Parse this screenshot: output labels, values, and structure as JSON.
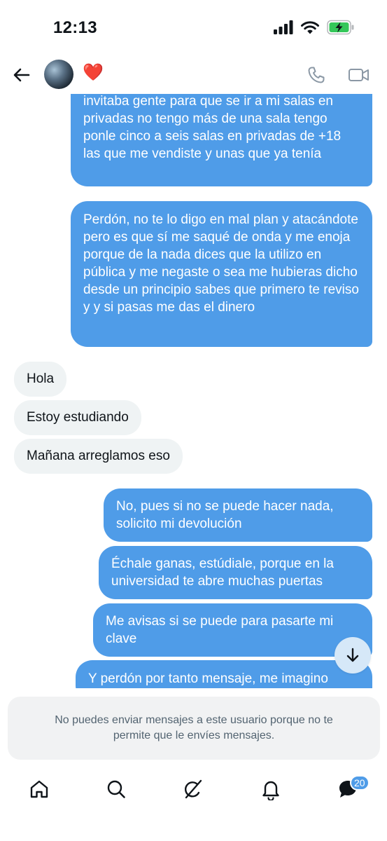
{
  "status_bar": {
    "time": "12:13",
    "icons": [
      "cellular-signal-icon",
      "wifi-icon",
      "battery-charging-icon"
    ],
    "battery_color": "#34c759"
  },
  "header": {
    "icons": [
      "back-arrow-icon",
      "phone-icon",
      "video-camera-icon"
    ],
    "status_emoji": "❤️"
  },
  "messages": [
    {
      "side": "out",
      "text": "invitaba gente para que se ir a mi salas en privadas no tengo más de una sala tengo ponle cinco a seis salas en privadas de +18 las que me vendiste y unas que ya tenía"
    },
    {
      "side": "out",
      "text": "Perdón, no te lo digo en mal plan y atacándote pero es que sí me saqué de onda y me enoja porque de la nada dices que la utilizo en pública y me negaste o sea me hubieras dicho desde un principio sabes que primero te reviso y y si pasas me das el dinero"
    },
    {
      "side": "in",
      "text": "Hola"
    },
    {
      "side": "in",
      "text": "Estoy estudiando"
    },
    {
      "side": "in",
      "text": "Mañana arreglamos eso"
    },
    {
      "side": "out",
      "text": "No, pues si no se puede hacer nada, solicito mi devolución"
    },
    {
      "side": "out",
      "text": "Échale ganas, estúdiale, porque en la universidad te abre muchas puertas"
    },
    {
      "side": "out",
      "text": "Me avisas si se puede para pasarte mi clave"
    },
    {
      "side": "out",
      "text": "Y perdón por tanto mensaje, me imagino"
    }
  ],
  "notice": "No puedes enviar mensajes a este usuario porque no te permite que le envíes mensajes.",
  "tabbar": {
    "items": [
      "home-icon",
      "search-icon",
      "grok-icon",
      "notifications-icon",
      "messages-icon"
    ],
    "messages_badge": "20"
  },
  "colors": {
    "outgoing_bubble": "#4f9ce8",
    "incoming_bubble": "#eff3f4",
    "accent": "#4f9ce8"
  }
}
